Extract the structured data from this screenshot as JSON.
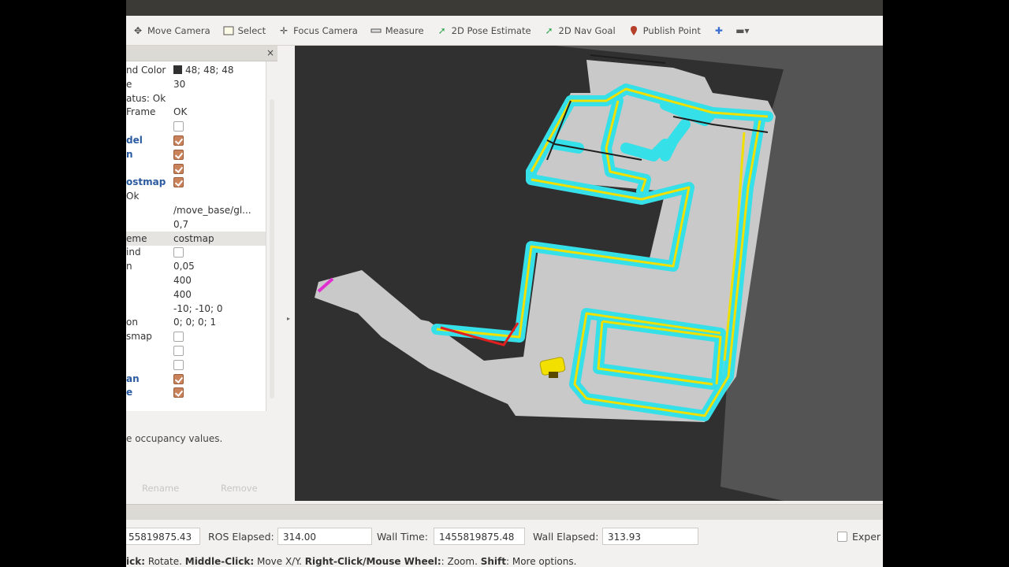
{
  "toolbar": {
    "tools": [
      {
        "label": "Move Camera",
        "icon": "move-camera-icon"
      },
      {
        "label": "Select",
        "icon": "select-icon"
      },
      {
        "label": "Focus Camera",
        "icon": "focus-camera-icon"
      },
      {
        "label": "Measure",
        "icon": "measure-icon"
      },
      {
        "label": "2D Pose Estimate",
        "icon": "pose-estimate-icon"
      },
      {
        "label": "2D Nav Goal",
        "icon": "nav-goal-icon"
      },
      {
        "label": "Publish Point",
        "icon": "publish-point-icon"
      }
    ],
    "extra_icons": [
      "plus-icon",
      "minus-dropdown-icon"
    ]
  },
  "panel": {
    "close": "×",
    "rows": [
      {
        "key": "nd Color",
        "value": "48; 48; 48",
        "type": "color",
        "color": "#303030"
      },
      {
        "key": "e",
        "value": "30"
      },
      {
        "key": "atus: Ok",
        "value": ""
      },
      {
        "key": "Frame",
        "value": "OK"
      },
      {
        "key": "",
        "value": "",
        "type": "checkbox",
        "checked": false
      },
      {
        "key": "del",
        "value": "",
        "type": "checkbox",
        "checked": true,
        "blue": true
      },
      {
        "key": "n",
        "value": "",
        "type": "checkbox",
        "checked": true,
        "blue": true
      },
      {
        "key": "",
        "value": "",
        "type": "checkbox",
        "checked": true
      },
      {
        "key": "ostmap",
        "value": "",
        "type": "checkbox",
        "checked": true,
        "blue": true
      },
      {
        "key": "Ok",
        "value": ""
      },
      {
        "key": "",
        "value": "/move_base/gl..."
      },
      {
        "key": "",
        "value": "0,7"
      },
      {
        "key": "eme",
        "value": "costmap",
        "selected": true
      },
      {
        "key": "ind",
        "value": "",
        "type": "checkbox",
        "checked": false
      },
      {
        "key": "n",
        "value": "0,05"
      },
      {
        "key": "",
        "value": "400"
      },
      {
        "key": "",
        "value": "400"
      },
      {
        "key": "",
        "value": "-10; -10; 0"
      },
      {
        "key": "on",
        "value": "0; 0; 0; 1"
      },
      {
        "key": "smap",
        "value": "",
        "type": "checkbox",
        "checked": false
      },
      {
        "key": "",
        "value": "",
        "type": "checkbox",
        "checked": false
      },
      {
        "key": "",
        "value": "",
        "type": "checkbox",
        "checked": false
      },
      {
        "key": "an",
        "value": "",
        "type": "checkbox",
        "checked": true,
        "blue": true
      },
      {
        "key": "e",
        "value": "",
        "type": "checkbox",
        "checked": true,
        "blue": true
      }
    ],
    "description": "e occupancy values.",
    "buttons": [
      "Rename",
      "Remove"
    ]
  },
  "time": {
    "ros_time_value": "55819875.43",
    "ros_elapsed_label": "ROS Elapsed:",
    "ros_elapsed_value": "314.00",
    "wall_time_label": "Wall Time:",
    "wall_time_value": "1455819875.48",
    "wall_elapsed_label": "Wall Elapsed:",
    "wall_elapsed_value": "313.93",
    "experimental_label": "Exper"
  },
  "status": {
    "p1": "ick:",
    "p2": " Rotate. ",
    "p3": "Middle-Click:",
    "p4": " Move X/Y. ",
    "p5": "Right-Click/Mouse Wheel:",
    "p6": ": Zoom. ",
    "p7": "Shift",
    "p8": ": More options."
  },
  "colors": {
    "view_background": "#303030",
    "map_free": "#c8c8c8",
    "inflation": "#35e0e8",
    "obstacle": "#f0e000",
    "plan": "#e02020",
    "robot": "#f2e000"
  }
}
